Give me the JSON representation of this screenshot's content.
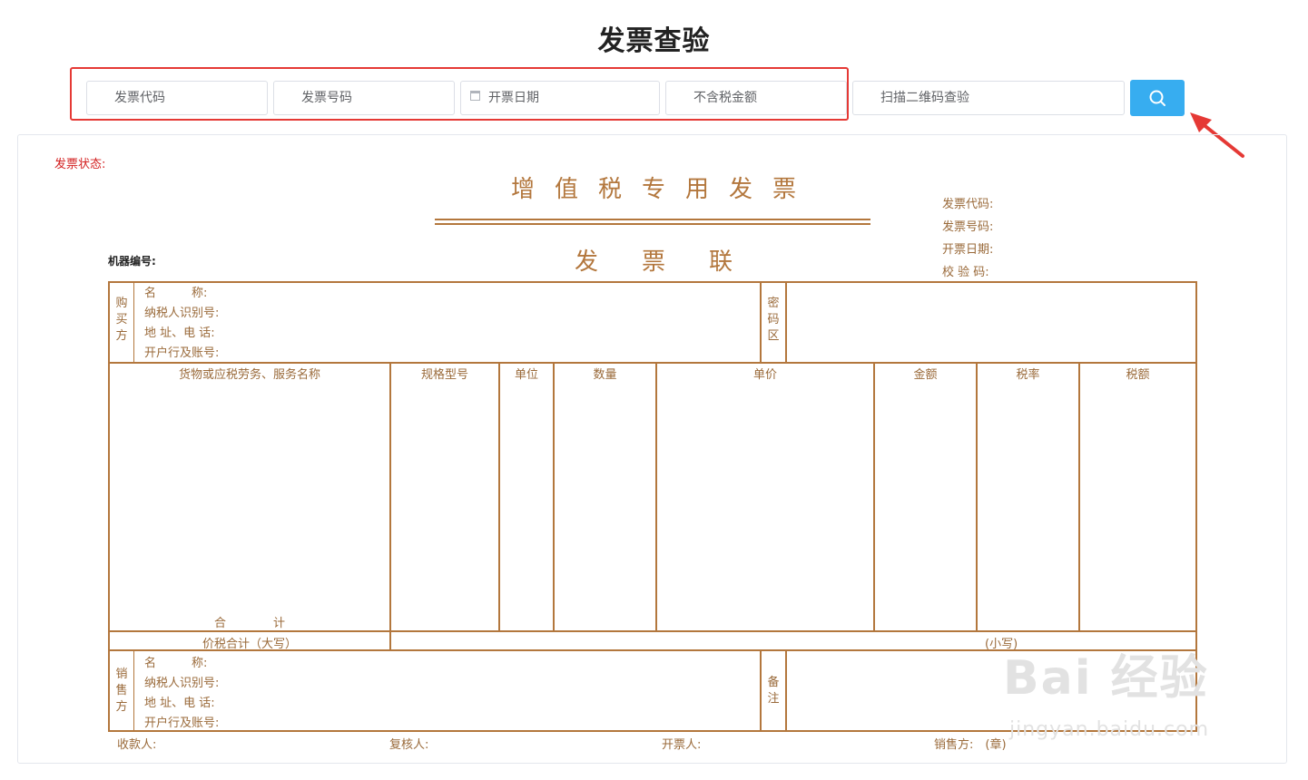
{
  "page": {
    "title": "发票查验"
  },
  "search": {
    "invoice_code_placeholder": "发票代码",
    "invoice_number_placeholder": "发票号码",
    "issue_date_placeholder": "开票日期",
    "amount_placeholder": "不含税金额",
    "qr_placeholder": "扫描二维码查验",
    "search_icon": "search-icon"
  },
  "invoice": {
    "status_label": "发票状态:",
    "title": "增值税专用发票",
    "copy_name": "发票联",
    "machine_no_label": "机器编号:",
    "meta": {
      "code_label": "发票代码:",
      "number_label": "发票号码:",
      "date_label": "开票日期:",
      "check_label": "校 验 码:"
    },
    "buyer": {
      "section": "购买方",
      "name_label": "名　　　称:",
      "tax_id_label": "纳税人识别号:",
      "address_label": "地 址、电 话:",
      "bank_label": "开户行及账号:"
    },
    "cipher_label": "密码区",
    "columns": [
      "货物或应税劳务、服务名称",
      "规格型号",
      "单位",
      "数量",
      "单价",
      "金额",
      "税率",
      "税额"
    ],
    "total_label": "合　　　　计",
    "total_tax_upper_label": "价税合计（大写）",
    "total_tax_lower_label": "(小写)",
    "seller": {
      "section": "销售方",
      "name_label": "名　　　称:",
      "tax_id_label": "纳税人识别号:",
      "address_label": "地 址、电 话:",
      "bank_label": "开户行及账号:"
    },
    "remarks_label": "备注",
    "footer": {
      "payee_label": "收款人:",
      "reviewer_label": "复核人:",
      "issuer_label": "开票人:",
      "seller_seal_label": "销售方:　(章)"
    }
  },
  "watermark": {
    "text": "Bai 经验",
    "url_text": "jingyan.baidu.com"
  },
  "colors": {
    "accent": "#37adf0",
    "invoice_brown": "#b3773d",
    "highlight_red": "#e53935",
    "status_red": "#d32020"
  }
}
